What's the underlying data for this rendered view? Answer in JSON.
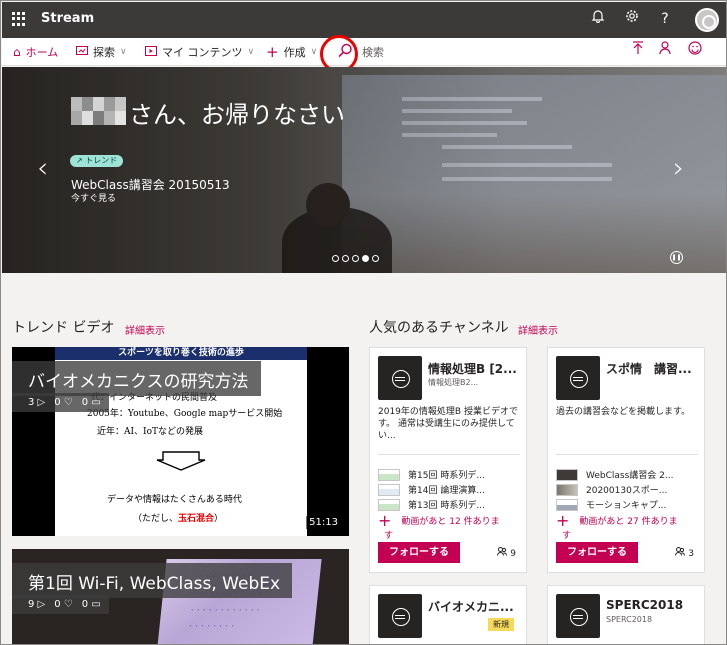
{
  "app": {
    "name": "Stream"
  },
  "topbar": {
    "icons": [
      "bell-icon",
      "gear-icon",
      "help-icon",
      "avatar"
    ]
  },
  "nav": {
    "home": "ホーム",
    "explore": "探索",
    "my_content": "マイ コンテンツ",
    "create": "作成",
    "search_placeholder": "検索"
  },
  "hero": {
    "welcome": "さん、お帰りなさい",
    "trend_badge": "トレンド",
    "title": "WebClass講習会 20150513",
    "action": "今すぐ見る",
    "slide_count": 5,
    "active_slide": 4
  },
  "trending": {
    "title": "トレンド ビデオ",
    "more": "詳細表示",
    "videos": [
      {
        "title": "バイオメカニクスの研究方法",
        "views": "3",
        "likes": "0",
        "comments": "0",
        "duration": "51:13",
        "slide": {
          "header": "スポーツを取り巻く技術の進歩",
          "line1": "代：インターネットの民間普及",
          "line2": "2005年：Youtube、Google mapサービス開始",
          "line3": "近年：AI、IoTなどの発展",
          "line4": "データや情報はたくさんある時代",
          "line5_prefix": "（ただし、",
          "line5_red": "玉石混合",
          "line5_suffix": "）"
        }
      },
      {
        "title": "第1回 Wi-Fi, WebClass, WebEx",
        "views": "9",
        "likes": "0",
        "comments": "0"
      }
    ]
  },
  "channels": {
    "title": "人気のあるチャンネル",
    "more": "詳細表示",
    "items": [
      {
        "name": "情報処理B [2...",
        "sub": "情報処理B2...",
        "desc": "2019年の情報処理B 授業ビデオです。 通常は受講生にのみ提供してい...",
        "videos": [
          "第15回 時系列デ...",
          "第14回 論理演算...",
          "第13回 時系列デ..."
        ],
        "more_line1": "動画があと 12 件ありま",
        "more_line2": "す",
        "follow": "フォローする",
        "followers": "9"
      },
      {
        "name": "スポ情　講習...",
        "desc": "過去の講習会などを掲載します。",
        "videos": [
          "WebClass講習会 2...",
          "20200130スポー...",
          "モーションキャプ..."
        ],
        "more_line1": "動画があと 27 件ありま",
        "more_line2": "す",
        "follow": "フォローする",
        "followers": "3"
      },
      {
        "name": "バイオメカニ...",
        "badge": "新規"
      },
      {
        "name": "SPERC2018",
        "sub": "SPERC2018"
      }
    ]
  },
  "colors": {
    "accent": "#c30052",
    "topbar": "#3b3a39"
  }
}
